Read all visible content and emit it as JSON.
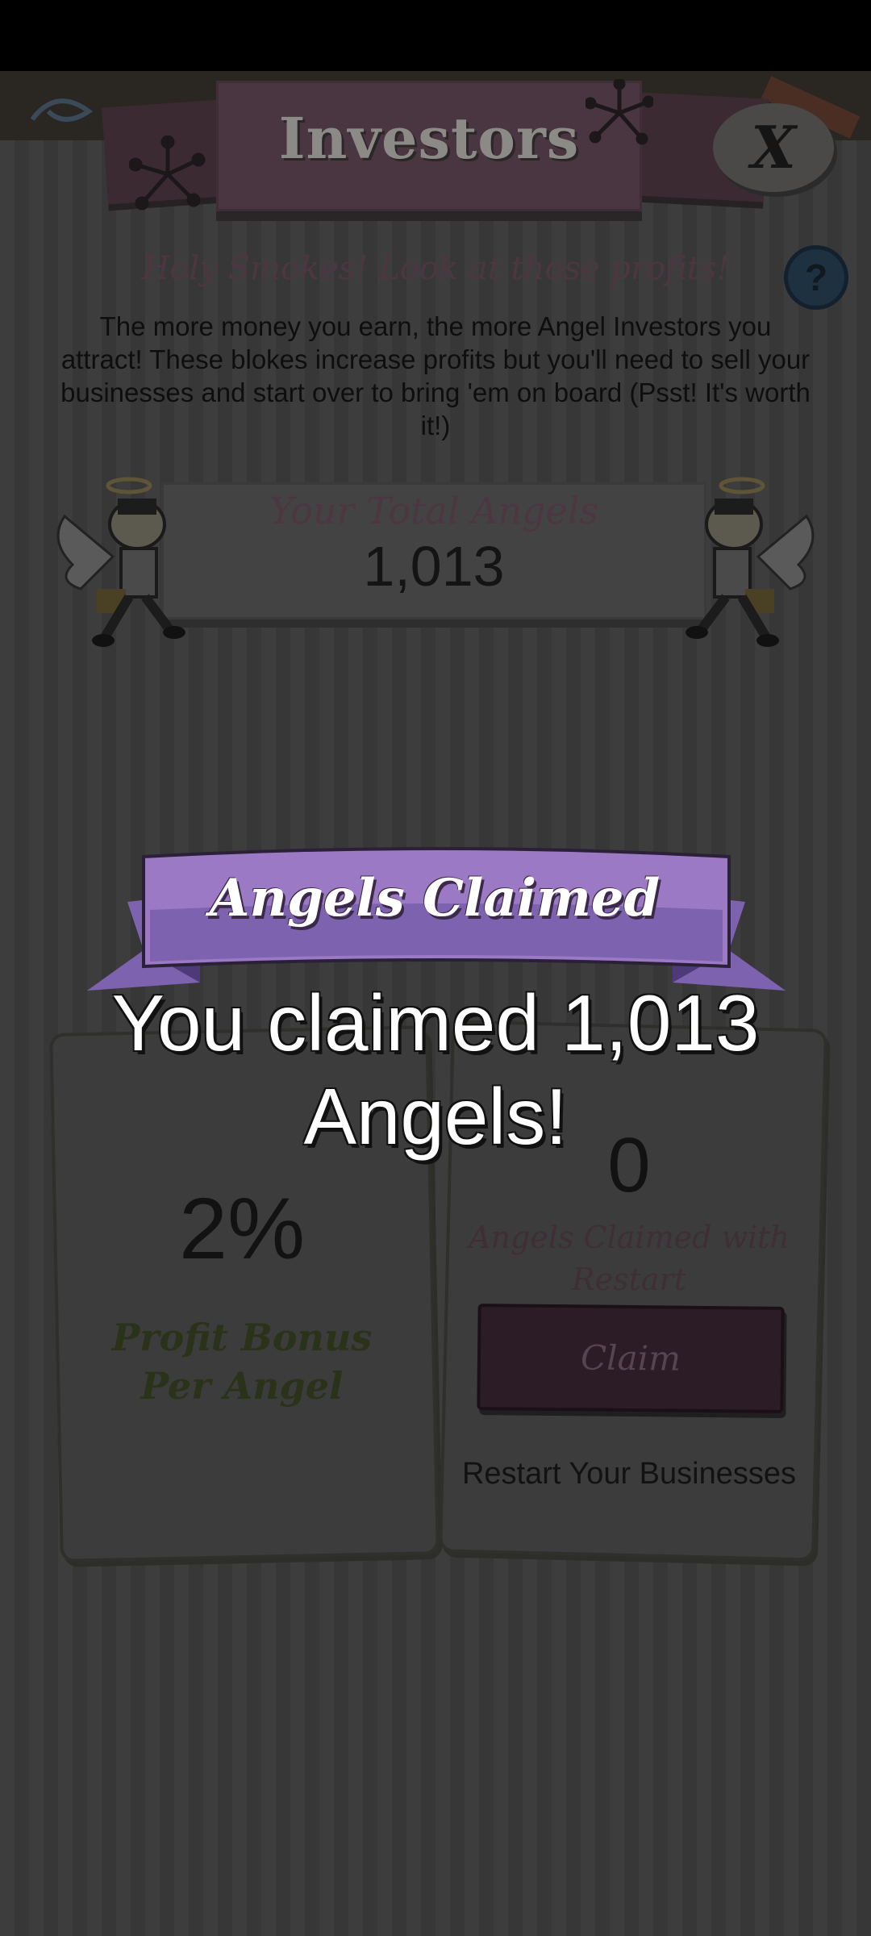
{
  "header": {
    "title": "Investors",
    "close_label": "X"
  },
  "intro": {
    "headline": "Holy Smokes! Look at those profits!",
    "help_label": "?",
    "description": "The more money you earn, the more Angel Investors you attract! These blokes increase profits but you'll need to sell your businesses and start over to bring 'em on board (Psst! It's worth it!)"
  },
  "total_angels": {
    "label": "Your Total Angels",
    "value": "1,013"
  },
  "bonus_card": {
    "value": "2%",
    "label": "Profit Bonus Per Angel"
  },
  "claim_card": {
    "count": "0",
    "label": "Angels Claimed with Restart",
    "button_label": "Claim",
    "restart_label": "Restart Your Businesses"
  },
  "overlay": {
    "ribbon_title": "Angels Claimed",
    "message": "You claimed 1,013 Angels!"
  },
  "colors": {
    "ribbon": "#9b79c4",
    "ribbon_dark": "#6f55a0",
    "panel": "#3a3a3a",
    "title_tab": "#4a3640"
  },
  "icons": [
    "close-icon",
    "help-icon",
    "snowflake-icon",
    "angel-mascot"
  ]
}
